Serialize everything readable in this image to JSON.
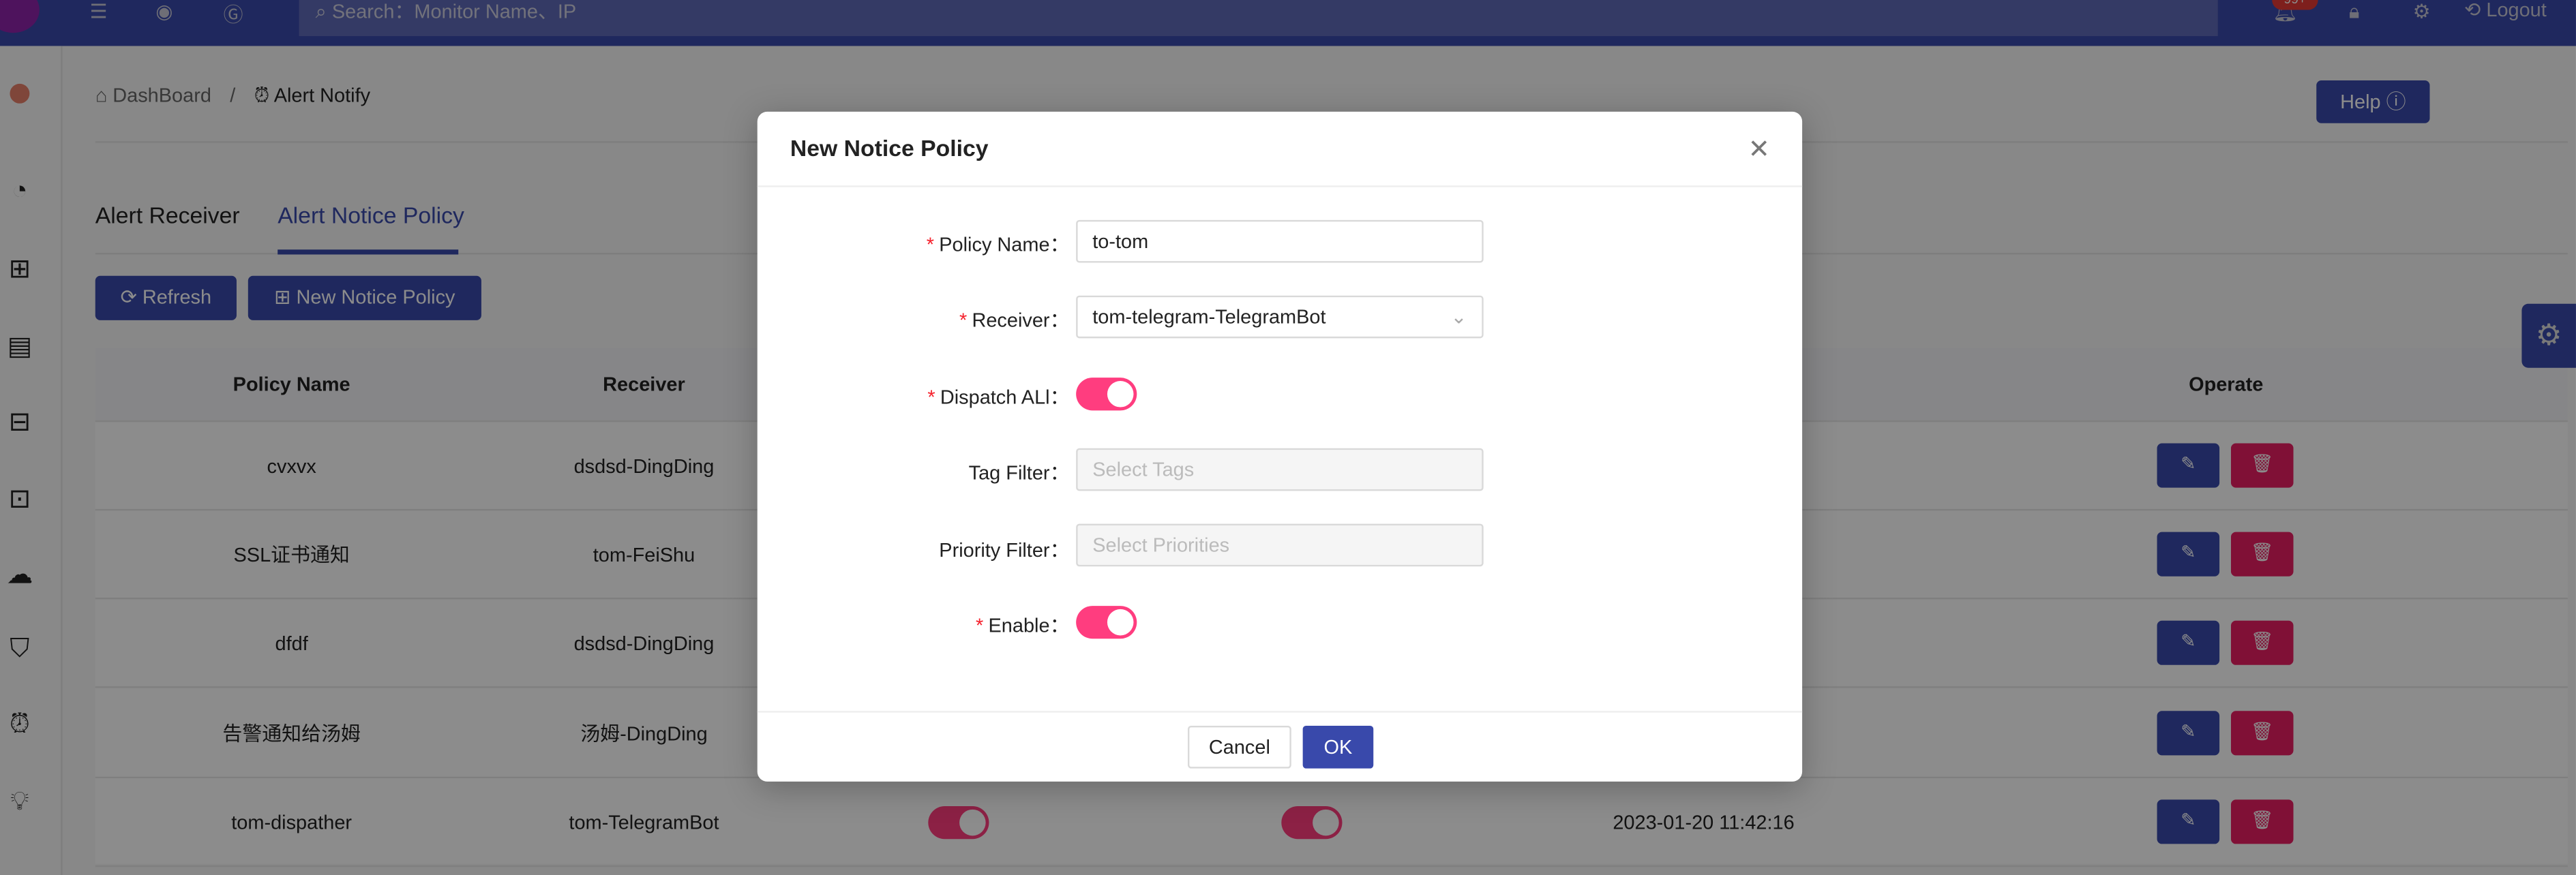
{
  "topbar": {
    "search_placeholder": "Search：Monitor Name、IP",
    "notification_badge": "99+",
    "logout_label": "Logout",
    "icons": [
      "menu-fold-icon",
      "github-icon",
      "gitee-icon",
      "bell-icon",
      "lock-icon",
      "gear-icon",
      "logout-icon"
    ]
  },
  "sidebar": {
    "icons": [
      "avatar",
      "dashboard-icon",
      "apps-icon",
      "server-icon",
      "widgets-icon",
      "cluster-icon",
      "cloud-icon",
      "shirt-icon",
      "alarm-icon",
      "bulb-icon"
    ]
  },
  "breadcrumb": {
    "home": "DashBoard",
    "separator": "/",
    "current": "Alert Notify"
  },
  "help_label": "Help",
  "tabs": [
    {
      "label": "Alert Receiver",
      "active": false
    },
    {
      "label": "Alert Notice Policy",
      "active": true
    }
  ],
  "toolbar": {
    "refresh_label": "Refresh",
    "new_label": "New Notice Policy"
  },
  "table": {
    "headers": {
      "policy_name": "Policy Name",
      "receiver": "Receiver",
      "operate": "Operate"
    },
    "rows": [
      {
        "policy_name": "cvxvx",
        "receiver": "dsdsd-DingDing"
      },
      {
        "policy_name": "SSL证书通知",
        "receiver": "tom-FeiShu"
      },
      {
        "policy_name": "dfdf",
        "receiver": "dsdsd-DingDing"
      },
      {
        "policy_name": "告警通知给汤姆",
        "receiver": "汤姆-DingDing"
      },
      {
        "policy_name": "tom-dispather",
        "receiver": "tom-TelegramBot",
        "dispatch_all": true,
        "enable": true,
        "time": "2023-01-20 11:42:16"
      }
    ]
  },
  "modal": {
    "title": "New Notice Policy",
    "fields": {
      "policy_name": {
        "label": "Policy Name",
        "value": "to-tom",
        "required": true
      },
      "receiver": {
        "label": "Receiver",
        "value": "tom-telegram-TelegramBot",
        "required": true
      },
      "dispatch_all": {
        "label": "Dispatch ALl",
        "value": true,
        "required": true
      },
      "tag_filter": {
        "label": "Tag Filter",
        "placeholder": "Select Tags"
      },
      "priority_filter": {
        "label": "Priority Filter",
        "placeholder": "Select Priorities"
      },
      "enable": {
        "label": "Enable",
        "value": true,
        "required": true
      }
    },
    "cancel_label": "Cancel",
    "ok_label": "OK"
  },
  "colors": {
    "primary": "#3949ab",
    "danger": "#e91e63",
    "switch_on": "#ff3d7f"
  }
}
